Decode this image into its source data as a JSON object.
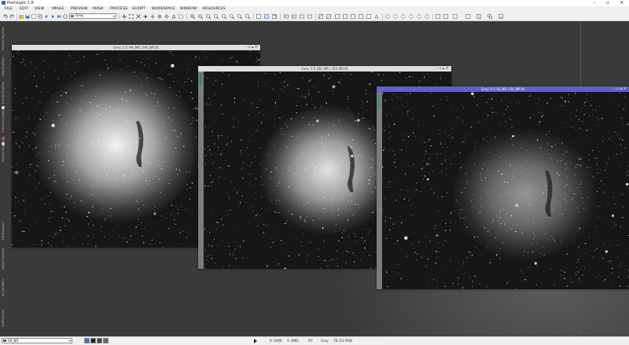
{
  "app": {
    "title": "PixInsight 1.8"
  },
  "menu": [
    "FILE",
    "EDIT",
    "VIEW",
    "IMAGE",
    "PREVIEW",
    "MASK",
    "PROCESS",
    "SCRIPT",
    "WORKSPACE",
    "WINDOW",
    "RESOURCES"
  ],
  "toolbar": {
    "view_selector": "Grey"
  },
  "windows": [
    {
      "title": "Grey 1:5 HA_NR | HA_NR.fit",
      "state": "inactive"
    },
    {
      "title": "Grey 1:5 OIII_NR | OIII_NR.fit",
      "state": "inactive"
    },
    {
      "title": "Grey 1:5 SII_NR | SII_NR.fit",
      "state": "active"
    }
  ],
  "window_controls": [
    "–",
    "▫",
    "▴",
    "✕"
  ],
  "sidebar_tabs": [
    "Process Explorer",
    "View Explorer",
    "Format Explorer",
    "Process Console",
    "History Explorer",
    "File Explorer",
    "Object Explorer",
    "Script Editor",
    "Preferences"
  ],
  "status": {
    "view": "SII_NR",
    "x": "X: 5409",
    "y": "Y: 3965",
    "fit": "FIT",
    "mode": "Grey",
    "value": "78.312 RGB"
  },
  "colors": {
    "active_titlebar": "#5c63c8",
    "mask_indicator": "#1c8c5a",
    "workspace": "#3a3a3a"
  }
}
